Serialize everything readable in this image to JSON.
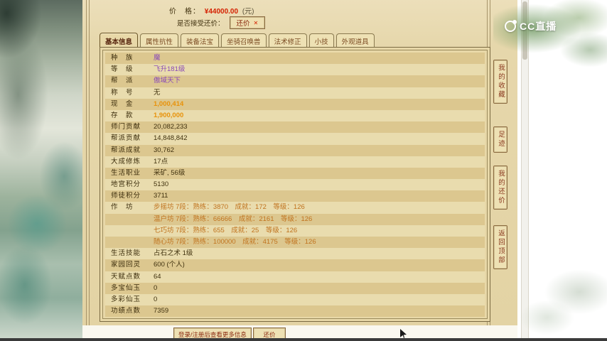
{
  "watermark": {
    "logo_text": "CC直播"
  },
  "header": {
    "price_label": "价　格：",
    "price_value": "¥44000.00",
    "price_unit": "(元)",
    "bargain_label": "是否接受还价：",
    "bargain_button_label": "还价"
  },
  "tabs": [
    {
      "id": "basic",
      "label": "基本信息",
      "active": true
    },
    {
      "id": "attrs",
      "label": "属性抗性",
      "active": false
    },
    {
      "id": "equip",
      "label": "装备法宝",
      "active": false
    },
    {
      "id": "mount",
      "label": "坐骑召唤兽",
      "active": false
    },
    {
      "id": "spell",
      "label": "法术修正",
      "active": false
    },
    {
      "id": "minor",
      "label": "小技",
      "active": false
    },
    {
      "id": "appearance",
      "label": "外观道具",
      "active": false
    }
  ],
  "info_lines": [
    {
      "label": "种　族",
      "value": "魔",
      "style": "purple"
    },
    {
      "label": "等　级",
      "value": "飞升181级",
      "style": "purple"
    },
    {
      "label": "帮　派",
      "value": "傲域天下",
      "style": "purple"
    },
    {
      "label": "称　号",
      "value": "无",
      "style": "dark"
    },
    {
      "label": "现　金",
      "value": "1,000,414",
      "style": "orange"
    },
    {
      "label": "存　款",
      "value": "1,900,000",
      "style": "orange"
    },
    {
      "label": "师门贡献",
      "value": "20,082,233",
      "style": "dark"
    },
    {
      "label": "帮派贡献",
      "value": "14,848,842",
      "style": "dark"
    },
    {
      "label": "帮派成就",
      "value": "30,762",
      "style": "dark"
    },
    {
      "label": "大成修炼",
      "value": "17点",
      "style": "dark"
    },
    {
      "label": "生活职业",
      "value": "采矿, 56级",
      "style": "dark"
    },
    {
      "label": "地宫积分",
      "value": "5130",
      "style": "dark"
    },
    {
      "label": "师徒积分",
      "value": "3711",
      "style": "dark"
    },
    {
      "label": "作　坊",
      "value": "步摇坊 7段：熟练：3870　成就：172　等级：126",
      "style": "work"
    },
    {
      "label": "",
      "value": "温户坊 7段：熟练：66666　成就：2161　等级：126",
      "style": "work"
    },
    {
      "label": "",
      "value": "七巧坊 7段：熟练：655　成就：25　等级：126",
      "style": "work"
    },
    {
      "label": "",
      "value": "随心坊 7段：熟练：100000　成就：4175　等级：126",
      "style": "work"
    },
    {
      "label": "生活技能",
      "value": "占石之术 1级",
      "style": "dark"
    },
    {
      "label": "家园回灵",
      "value": "600 (个人)",
      "style": "dark"
    },
    {
      "label": "天赋点数",
      "value": "64",
      "style": "dark"
    },
    {
      "label": "多宝仙玉",
      "value": "0",
      "style": "dark"
    },
    {
      "label": "多彩仙玉",
      "value": "0",
      "style": "dark"
    },
    {
      "label": "功绩点数",
      "value": "7359",
      "style": "dark"
    }
  ],
  "side_nav": [
    {
      "id": "favorites",
      "label": "我的收藏"
    },
    {
      "id": "footprints",
      "label": "足迹"
    },
    {
      "id": "my-bargains",
      "label": "我的还价"
    },
    {
      "id": "back-to-top",
      "label": "返回顶部"
    }
  ],
  "footer": {
    "login_button_label": "登录/注册后查看更多信息",
    "bargain_button_label": "还价"
  },
  "colors": {
    "price_red": "#d42000",
    "money_orange": "#e8920a",
    "value_purple": "#8a4bb8",
    "workshop_brown": "#c0731e"
  }
}
